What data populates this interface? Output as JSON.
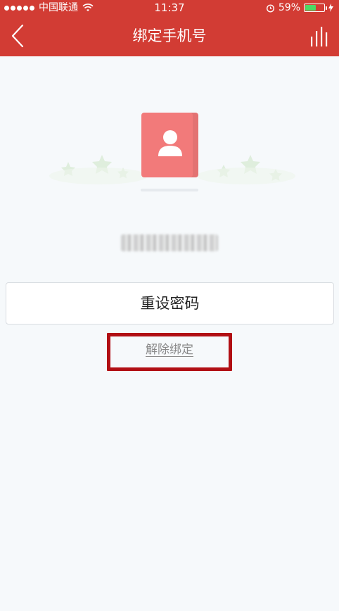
{
  "status_bar": {
    "carrier": "中国联通",
    "time": "11:37",
    "battery_percent": "59%",
    "battery_level": 0.59,
    "signal_bars_filled": 5
  },
  "navbar": {
    "title": "绑定手机号",
    "back_icon": "chevron-left-icon",
    "right_icon": "bar-chart-icon"
  },
  "profile": {
    "phone_number_masked": "",
    "avatar_icon": "user-contact-icon"
  },
  "actions": {
    "reset_password_label": "重设密码",
    "unbind_label": "解除绑定"
  },
  "colors": {
    "header_bg": "#d23c34",
    "avatar_card": "#f27a7a",
    "highlight_border": "#b10f14",
    "page_bg": "#f6f9fb"
  }
}
